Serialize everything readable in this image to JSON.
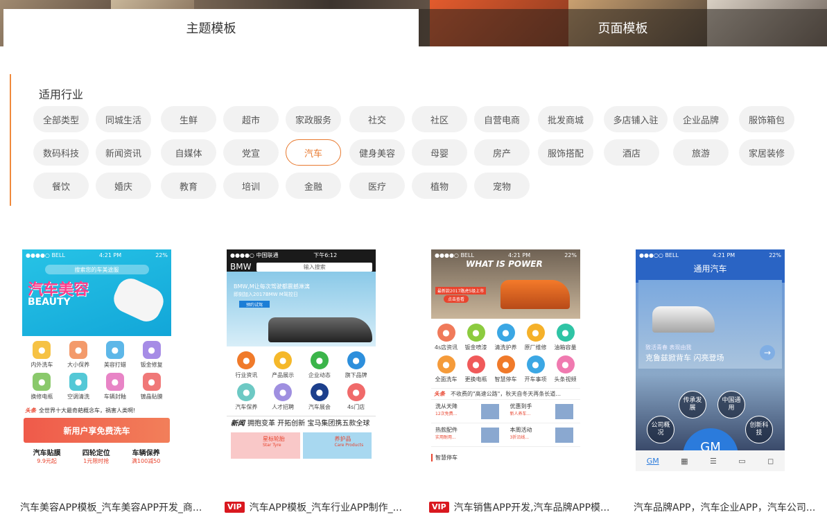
{
  "tabs": [
    {
      "label": "主题模板",
      "active": true
    },
    {
      "label": "页面模板",
      "active": false
    }
  ],
  "filter": {
    "title": "适用行业",
    "chips": [
      "全部类型",
      "同城生活",
      "生鲜",
      "超市",
      "家政服务",
      "社交",
      "社区",
      "自营电商",
      "批发商城",
      "多店铺入驻",
      "企业品牌",
      "服饰箱包",
      "数码科技",
      "新闻资讯",
      "自媒体",
      "党宣",
      "汽车",
      "健身美容",
      "母婴",
      "房产",
      "服饰搭配",
      "酒店",
      "旅游",
      "家居装修",
      "餐饮",
      "婚庆",
      "教育",
      "培训",
      "金融",
      "医疗",
      "植物",
      "宠物"
    ],
    "active": "汽车"
  },
  "colors": {
    "accent": "#e8792e",
    "vip": "#d9181f"
  },
  "cards": [
    {
      "caption": "汽车美容APP模板_汽车美容APP开发_商...",
      "vip": false,
      "status": {
        "carrier": "●●●●○ BELL",
        "time": "4:21 PM",
        "battery": "22%"
      },
      "search_placeholder": "搜索您的车美途服",
      "banner_title": "汽车美容",
      "banner_sub": "BEAUTY",
      "icons": [
        {
          "label": "内外洗车",
          "color": "#f6c244",
          "icon": "car-wash-icon"
        },
        {
          "label": "大小保养",
          "color": "#f39a6b",
          "icon": "oil-icon"
        },
        {
          "label": "美容打蜡",
          "color": "#5db7e8",
          "icon": "wax-icon"
        },
        {
          "label": "钣金修复",
          "color": "#a68ce6",
          "icon": "repair-icon"
        },
        {
          "label": "换修电瓶",
          "color": "#8ac96b",
          "icon": "battery-icon"
        },
        {
          "label": "空调清洗",
          "color": "#54c8d6",
          "icon": "ac-icon"
        },
        {
          "label": "车辆封釉",
          "color": "#e884c6",
          "icon": "glaze-icon"
        },
        {
          "label": "镀晶贴膜",
          "color": "#f07878",
          "icon": "diamond-icon"
        }
      ],
      "headline_tag": "头条",
      "headline": "全世界十大最奇葩概念车，祸害人类啊!",
      "promo": "新用户享免费洗车",
      "products": [
        {
          "name": "汽车贴膜",
          "price": "9.9元起"
        },
        {
          "name": "四轮定位",
          "price": "1元限时抢"
        },
        {
          "name": "车辆保养",
          "price": "满100减50"
        }
      ]
    },
    {
      "caption": "汽车APP模板_汽车行业APP制作_...",
      "vip": true,
      "vip_label": "VIP",
      "status": {
        "carrier": "●●●●○ 中国联通",
        "time": "下午6:12",
        "battery": ""
      },
      "brand": "BMW",
      "search_placeholder": "输入搜索",
      "banner_title": "BMW,M让每次驾驶都震撼淋漓",
      "banner_sub": "即刻加入2017BMW M驾控日",
      "banner_btn": "预约试驾",
      "icons": [
        {
          "label": "行业资讯",
          "color": "#f07a2a",
          "icon": "globe-icon"
        },
        {
          "label": "产品展示",
          "color": "#f5b82a",
          "icon": "share-icon"
        },
        {
          "label": "企业动态",
          "color": "#3bb54a",
          "icon": "sliders-icon"
        },
        {
          "label": "旗下品牌",
          "color": "#2d8fdc",
          "icon": "link-icon"
        },
        {
          "label": "汽车保养",
          "color": "#6dc9c4",
          "icon": "shield-icon"
        },
        {
          "label": "人才招聘",
          "color": "#9f8fe0",
          "icon": "user-icon"
        },
        {
          "label": "汽车展会",
          "color": "#1c3f8c",
          "icon": "star-icon"
        },
        {
          "label": "4s门店",
          "color": "#f06a6a",
          "icon": "location-icon"
        }
      ],
      "news_tag": "新闻",
      "news": "拥抱变革 开拓创新 宝马集团携五款全球",
      "products": [
        {
          "name": "星标轮胎",
          "sub": "Star Tyre"
        },
        {
          "name": "养护品",
          "sub": "Care Products"
        }
      ]
    },
    {
      "caption": "汽车销售APP开发,汽车品牌APP模...",
      "vip": true,
      "vip_label": "VIP",
      "status": {
        "carrier": "●●●●○ BELL",
        "time": "4:21 PM",
        "battery": "22%"
      },
      "banner_title": "WHAT IS POWER",
      "banner_tag": "最新款2017路虎5级上市",
      "banner_btn": "点击查看",
      "icons": [
        {
          "label": "4s店资讯",
          "color": "#f07a5a",
          "icon": "doc-icon"
        },
        {
          "label": "钣金喷漆",
          "color": "#8ccb3f",
          "icon": "spray-icon"
        },
        {
          "label": "清洗护养",
          "color": "#3ba7e4",
          "icon": "hand-icon"
        },
        {
          "label": "原厂维修",
          "color": "#f5b12a",
          "icon": "tools-icon"
        },
        {
          "label": "油箱容量",
          "color": "#2fc4a5",
          "icon": "fuel-icon"
        },
        {
          "label": "全面洗车",
          "color": "#f59b3a",
          "icon": "car-icon"
        },
        {
          "label": "更换电瓶",
          "color": "#f05a5a",
          "icon": "battery-icon"
        },
        {
          "label": "智慧停车",
          "color": "#f07a2a",
          "icon": "parking-icon"
        },
        {
          "label": "开车事项",
          "color": "#3ba7e4",
          "icon": "traffic-icon"
        },
        {
          "label": "头条视频",
          "color": "#f07ab0",
          "icon": "video-icon"
        }
      ],
      "headline_tag": "头条",
      "headline": "不收费的\"高速公路\"，秋天自冬天再条长道...",
      "deals": [
        {
          "title": "洗从天降",
          "sub": "12次免费..."
        },
        {
          "title": "优惠到手",
          "sub": "新人养车..."
        },
        {
          "title": "热款配件",
          "sub": "实用耐用..."
        },
        {
          "title": "本周活动",
          "sub": "3折沿线..."
        }
      ],
      "section": "智慧停车"
    },
    {
      "caption": "汽车品牌APP，汽车企业APP，汽车公司...",
      "vip": false,
      "status": {
        "carrier": "●●●○○ BELL",
        "time": "4:21 PM",
        "battery": "22%"
      },
      "title": "通用汽车",
      "slogan_sub": "致活青春 表现由我",
      "slogan": "克鲁兹掀背车 闪亮登场",
      "bubbles": [
        "传承发展",
        "中国通用",
        "公司概况",
        "创新科技"
      ],
      "logo": "GM",
      "nav": [
        "GM",
        "grid-icon",
        "list-icon",
        "chat-icon",
        "bag-icon"
      ]
    }
  ]
}
